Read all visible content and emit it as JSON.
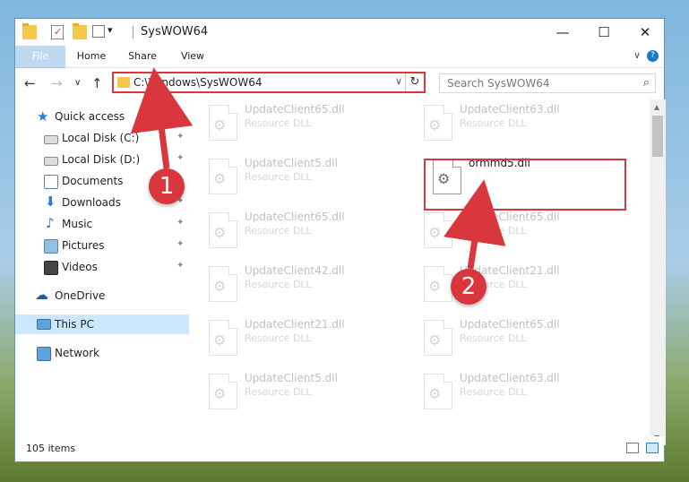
{
  "window": {
    "title": "SysWOW64"
  },
  "titlebar": {
    "minimize": "—",
    "maximize": "☐",
    "close": "✕",
    "qa_dropdown": "▾"
  },
  "ribbon": {
    "tabs": [
      "File",
      "Home",
      "Share",
      "View"
    ],
    "expand": "∨",
    "help": "?"
  },
  "nav": {
    "back": "←",
    "forward": "→",
    "recent": "∨",
    "up": "↑"
  },
  "address": {
    "path": "C:\\Windows\\SysWOW64",
    "dropdown": "∨",
    "refresh": "↻"
  },
  "search": {
    "placeholder": "Search SysWOW64",
    "icon": "⌕"
  },
  "sidebar": {
    "items": [
      {
        "label": "Quick access",
        "icon": "star-icon",
        "pinned": false
      },
      {
        "label": "Local Disk (C:)",
        "icon": "drive-icon",
        "pinned": true
      },
      {
        "label": "Local Disk (D:)",
        "icon": "drive-icon",
        "pinned": true
      },
      {
        "label": "Documents",
        "icon": "documents-icon",
        "pinned": true
      },
      {
        "label": "Downloads",
        "icon": "download-icon",
        "pinned": true
      },
      {
        "label": "Music",
        "icon": "music-icon",
        "pinned": true
      },
      {
        "label": "Pictures",
        "icon": "pictures-icon",
        "pinned": true
      },
      {
        "label": "Videos",
        "icon": "videos-icon",
        "pinned": true
      },
      {
        "label": "OneDrive",
        "icon": "cloud-icon",
        "pinned": false
      },
      {
        "label": "This PC",
        "icon": "computer-icon",
        "pinned": false,
        "selected": true
      },
      {
        "label": "Network",
        "icon": "network-icon",
        "pinned": false
      }
    ],
    "pin_glyph": "📌"
  },
  "files": {
    "left": [
      {
        "name": "UpdateClient65.dll",
        "type": "Resource DLL"
      },
      {
        "name": "UpdateClient5.dll",
        "type": "Resource DLL"
      },
      {
        "name": "UpdateClient65.dll",
        "type": "Resource DLL"
      },
      {
        "name": "UpdateClient42.dll",
        "type": "Resource DLL"
      },
      {
        "name": "UpdateClient21.dll",
        "type": "Resource DLL"
      },
      {
        "name": "UpdateClient5.dll",
        "type": "Resource DLL"
      }
    ],
    "right": [
      {
        "name": "UpdateClient63.dll",
        "type": "Resource DLL"
      },
      {
        "name": "ormmd5.dll",
        "type": "",
        "highlighted": true
      },
      {
        "name": "UpdateClient65.dll",
        "type": "Resource DLL"
      },
      {
        "name": "UpdateClient21.dll",
        "type": "Resource DLL"
      },
      {
        "name": "UpdateClient65.dll",
        "type": "Resource DLL"
      },
      {
        "name": "UpdateClient63.dll",
        "type": "Resource DLL"
      }
    ]
  },
  "status": {
    "count": "105 items"
  },
  "callouts": [
    "1",
    "2"
  ],
  "colors": {
    "accent": "#1979ca",
    "highlight_red": "#d9363e",
    "selected_bg": "#cce8ff"
  }
}
